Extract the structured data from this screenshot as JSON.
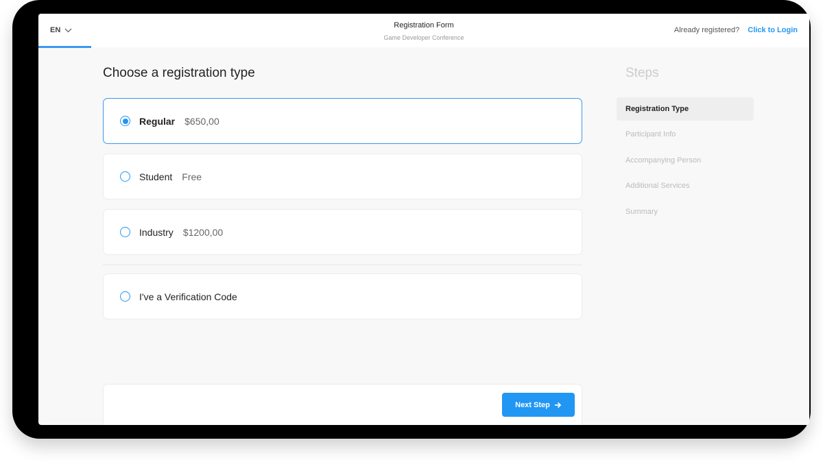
{
  "header": {
    "language": "EN",
    "title": "Registration Form",
    "subtitle": "Game Developer Conference",
    "already_registered": "Already registered?",
    "login_link": "Click to Login"
  },
  "main": {
    "heading": "Choose a registration type",
    "options": [
      {
        "label": "Regular",
        "price": "$650,00",
        "selected": true
      },
      {
        "label": "Student",
        "price": "Free",
        "selected": false
      },
      {
        "label": "Industry",
        "price": "$1200,00",
        "selected": false
      },
      {
        "label": "I've a Verification Code",
        "selected": false
      }
    ],
    "next_button": "Next Step"
  },
  "steps": {
    "title": "Steps",
    "items": [
      "Registration Type",
      "Participant Info",
      "Accompanying Person",
      "Additional Services",
      "Summary"
    ],
    "active": 0
  },
  "colors": {
    "accent": "#2196f3"
  }
}
